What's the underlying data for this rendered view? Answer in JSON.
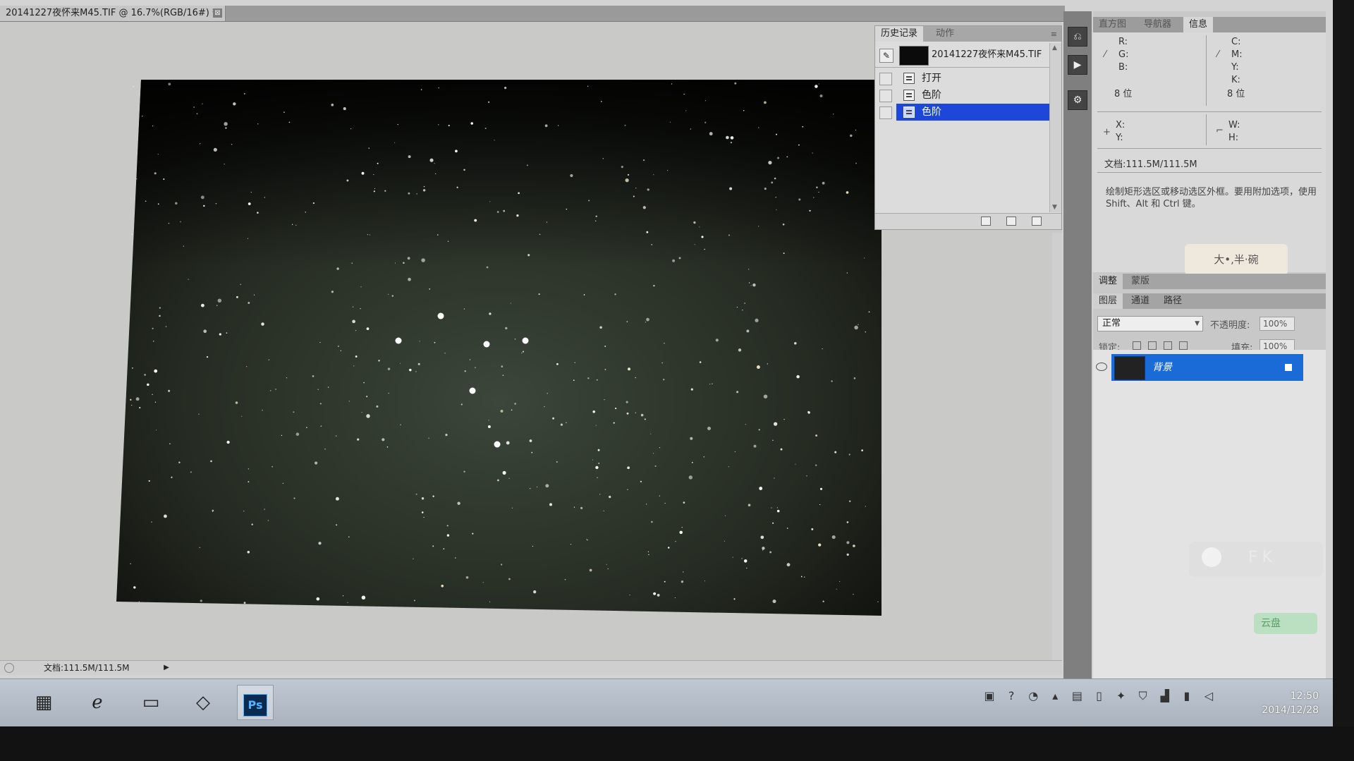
{
  "document": {
    "tab_title": "20141227夜怀来M45.TIF @ 16.7%(RGB/16#) *",
    "close_glyph": "⊠"
  },
  "status_bar": {
    "doc_size": "文档:111.5M/111.5M",
    "arrow_glyph": "▶"
  },
  "history_panel": {
    "tabs": [
      "历史记录",
      "动作"
    ],
    "snapshot_name": "20141227夜怀来M45.TIF",
    "steps": [
      {
        "label": "打开",
        "selected": false
      },
      {
        "label": "色阶",
        "selected": false
      },
      {
        "label": "色阶",
        "selected": true
      }
    ],
    "selection_color": "#1c47d8"
  },
  "info_panel": {
    "tabs": [
      "直方图",
      "导航器",
      "信息"
    ],
    "rgb_labels": [
      "R:",
      "G:",
      "B:"
    ],
    "cmyk_labels": [
      "C:",
      "M:",
      "Y:",
      "K:"
    ],
    "bit_depth_left": "8 位",
    "bit_depth_right": "8 位",
    "xy_labels": [
      "X:",
      "Y:"
    ],
    "wh_labels": [
      "W:",
      "H:"
    ],
    "doc_size": "文档:111.5M/111.5M",
    "hint": "绘制矩形选区或移动选区外框。要用附加选项，使用 Shift、Alt 和 Ctrl 键。"
  },
  "sticker_text": "大•,半·碗",
  "adjust_tabs": [
    "调整",
    "蒙版"
  ],
  "layers_panel": {
    "tabs": [
      "图层",
      "通道",
      "路径"
    ],
    "blend_mode": "正常",
    "opacity_label": "不透明度:",
    "opacity_value": "100%",
    "lock_label": "锁定:",
    "fill_label": "填充:",
    "fill_value": "100%",
    "layer_name": "背景",
    "layer_color": "#1a6bd7"
  },
  "overlay": {
    "float_letters": "F  K",
    "cloud_label": "云盘"
  },
  "taskbar": {
    "ps_label": "Ps",
    "clock_time": "12:50",
    "clock_date": "2014/12/28"
  }
}
